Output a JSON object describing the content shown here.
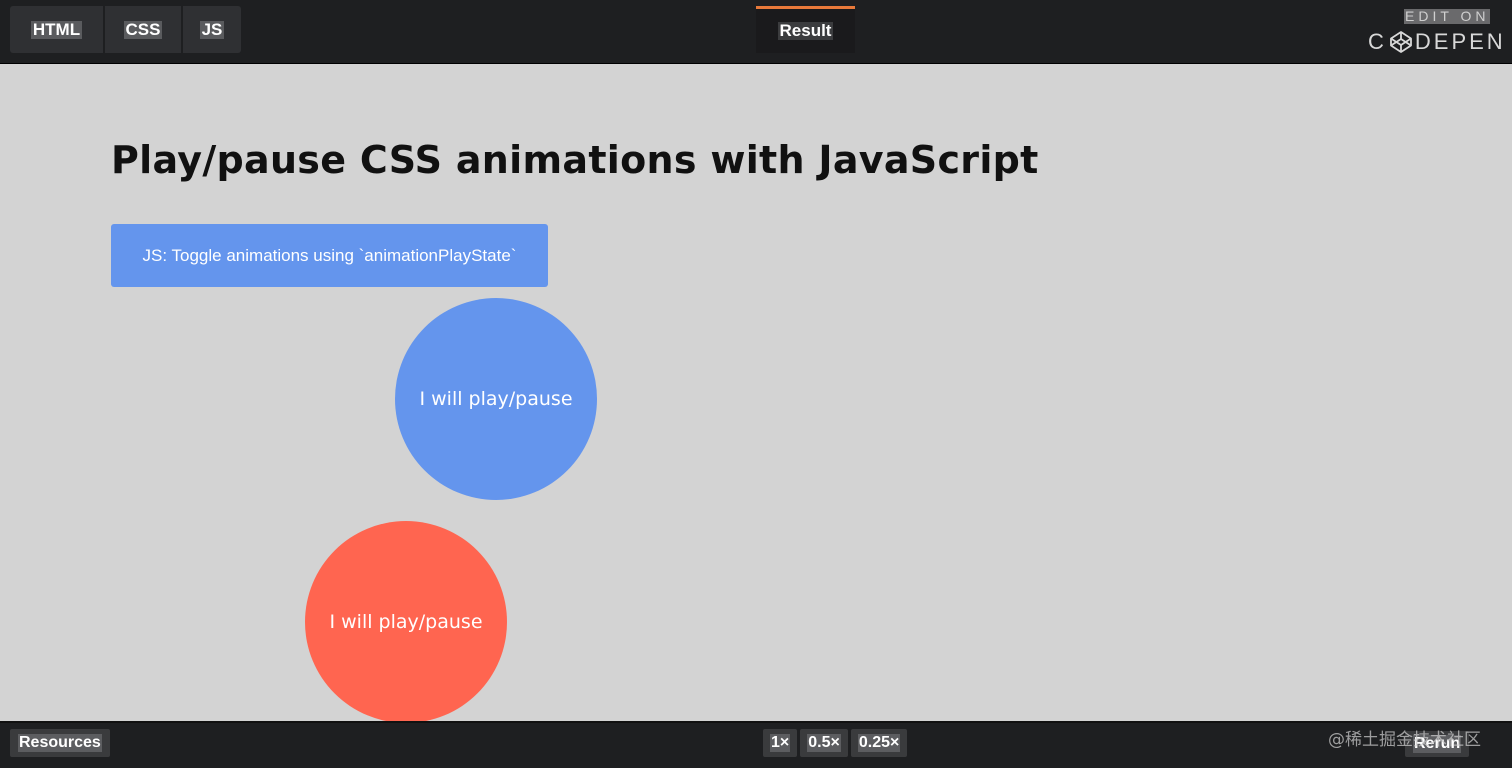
{
  "top_bar": {
    "tabs": [
      {
        "label": "HTML"
      },
      {
        "label": "CSS"
      },
      {
        "label": "JS"
      }
    ],
    "result_tab": {
      "label": "Result"
    },
    "edit_on": "EDIT ON",
    "logo": {
      "c": "C",
      "rest": "DEPEN"
    }
  },
  "content": {
    "heading": "Play/pause CSS animations with JavaScript",
    "toggle_button": "JS: Toggle animations using `animationPlayState`",
    "circles": [
      {
        "label": "I will play/pause",
        "color": "#6495ed"
      },
      {
        "label": "I will play/pause",
        "color": "#ff6550"
      }
    ]
  },
  "bottom_bar": {
    "resources": "Resources",
    "speeds": [
      "1×",
      "0.5×",
      "0.25×"
    ],
    "rerun": "Rerun",
    "watermark": "@稀土掘金技术社区"
  },
  "colors": {
    "accent_tab": "#e8793a",
    "stage_background": "#d3d3d3",
    "button_blue": "#6495ed"
  }
}
